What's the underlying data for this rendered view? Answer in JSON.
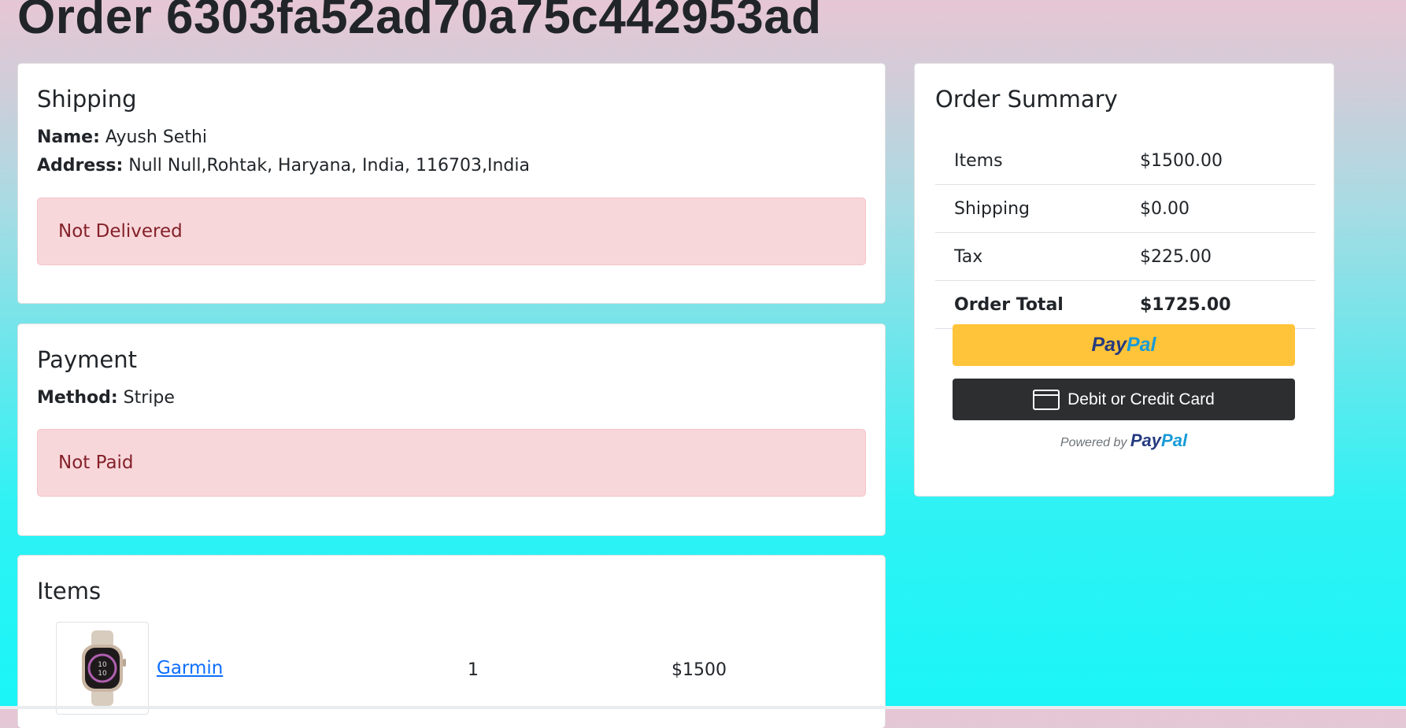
{
  "page": {
    "title": "Order 6303fa52ad70a75c442953ad"
  },
  "shipping": {
    "heading": "Shipping",
    "name_label": "Name:",
    "name_value": "Ayush Sethi",
    "address_label": "Address:",
    "address_value": "Null Null,Rohtak, Haryana, India, 116703,India",
    "status": "Not Delivered"
  },
  "payment": {
    "heading": "Payment",
    "method_label": "Method:",
    "method_value": "Stripe",
    "status": "Not Paid"
  },
  "items": {
    "heading": "Items",
    "list": [
      {
        "name": "Garmin",
        "quantity": "1",
        "price": "$1500",
        "image_icon": "smartwatch-icon"
      }
    ]
  },
  "summary": {
    "heading": "Order Summary",
    "rows": [
      {
        "label": "Items",
        "value": "$1500.00"
      },
      {
        "label": "Shipping",
        "value": "$0.00"
      },
      {
        "label": "Tax",
        "value": "$225.00"
      },
      {
        "label": "Order Total",
        "value": "$1725.00"
      }
    ],
    "paypal_button": {
      "part1": "Pay",
      "part2": "Pal"
    },
    "card_button_label": "Debit or Credit Card",
    "powered_by": {
      "prefix": "Powered by",
      "part1": "Pay",
      "part2": "Pal"
    }
  },
  "colors": {
    "alert_bg": "#f8d7da",
    "alert_text": "#842029",
    "paypal_yellow": "#ffc439",
    "card_button_bg": "#2c2e2f",
    "link": "#0d6efd"
  }
}
